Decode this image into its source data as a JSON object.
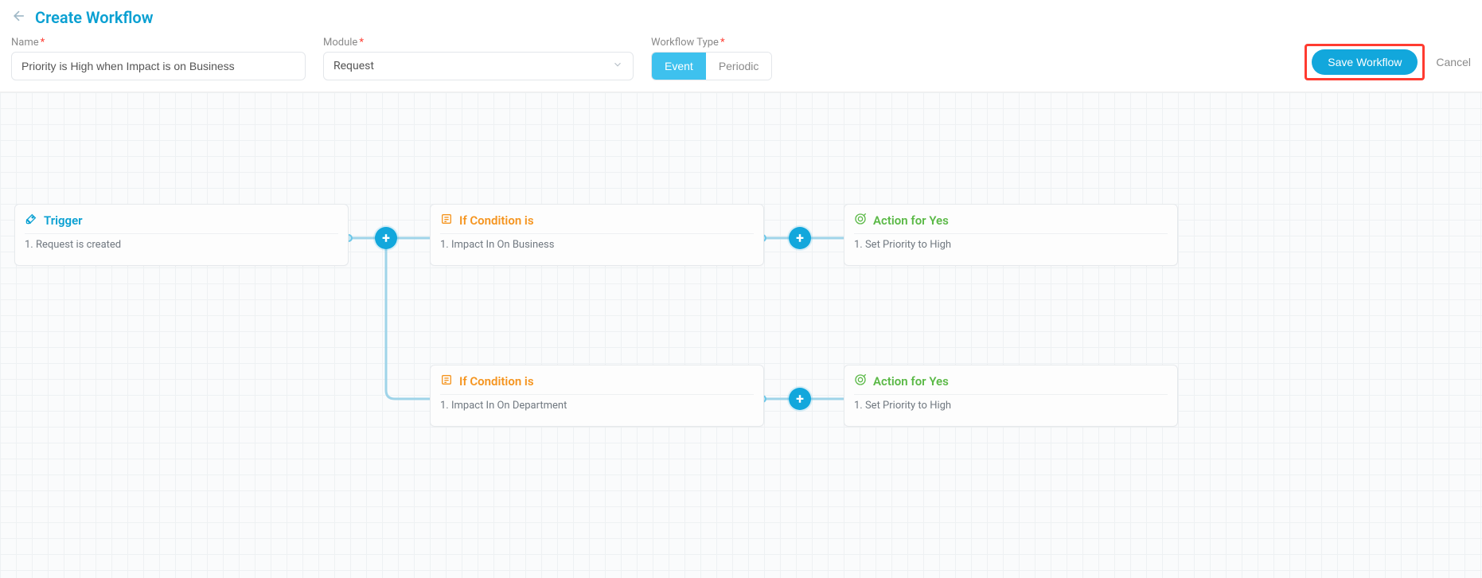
{
  "header": {
    "title": "Create Workflow"
  },
  "form": {
    "name_label": "Name",
    "name_value": "Priority is High when Impact is on Business",
    "module_label": "Module",
    "module_value": "Request",
    "type_label": "Workflow Type",
    "type_event": "Event",
    "type_periodic": "Periodic",
    "save_label": "Save Workflow",
    "cancel_label": "Cancel"
  },
  "nodes": {
    "trigger": {
      "title": "Trigger",
      "item": "1. Request is created"
    },
    "cond1": {
      "title": "If Condition is",
      "item": "1. Impact In On Business"
    },
    "cond2": {
      "title": "If Condition is",
      "item": "1. Impact In On Department"
    },
    "act1": {
      "title": "Action for Yes",
      "item": "1. Set Priority to High"
    },
    "act2": {
      "title": "Action for Yes",
      "item": "1. Set Priority to High"
    }
  }
}
